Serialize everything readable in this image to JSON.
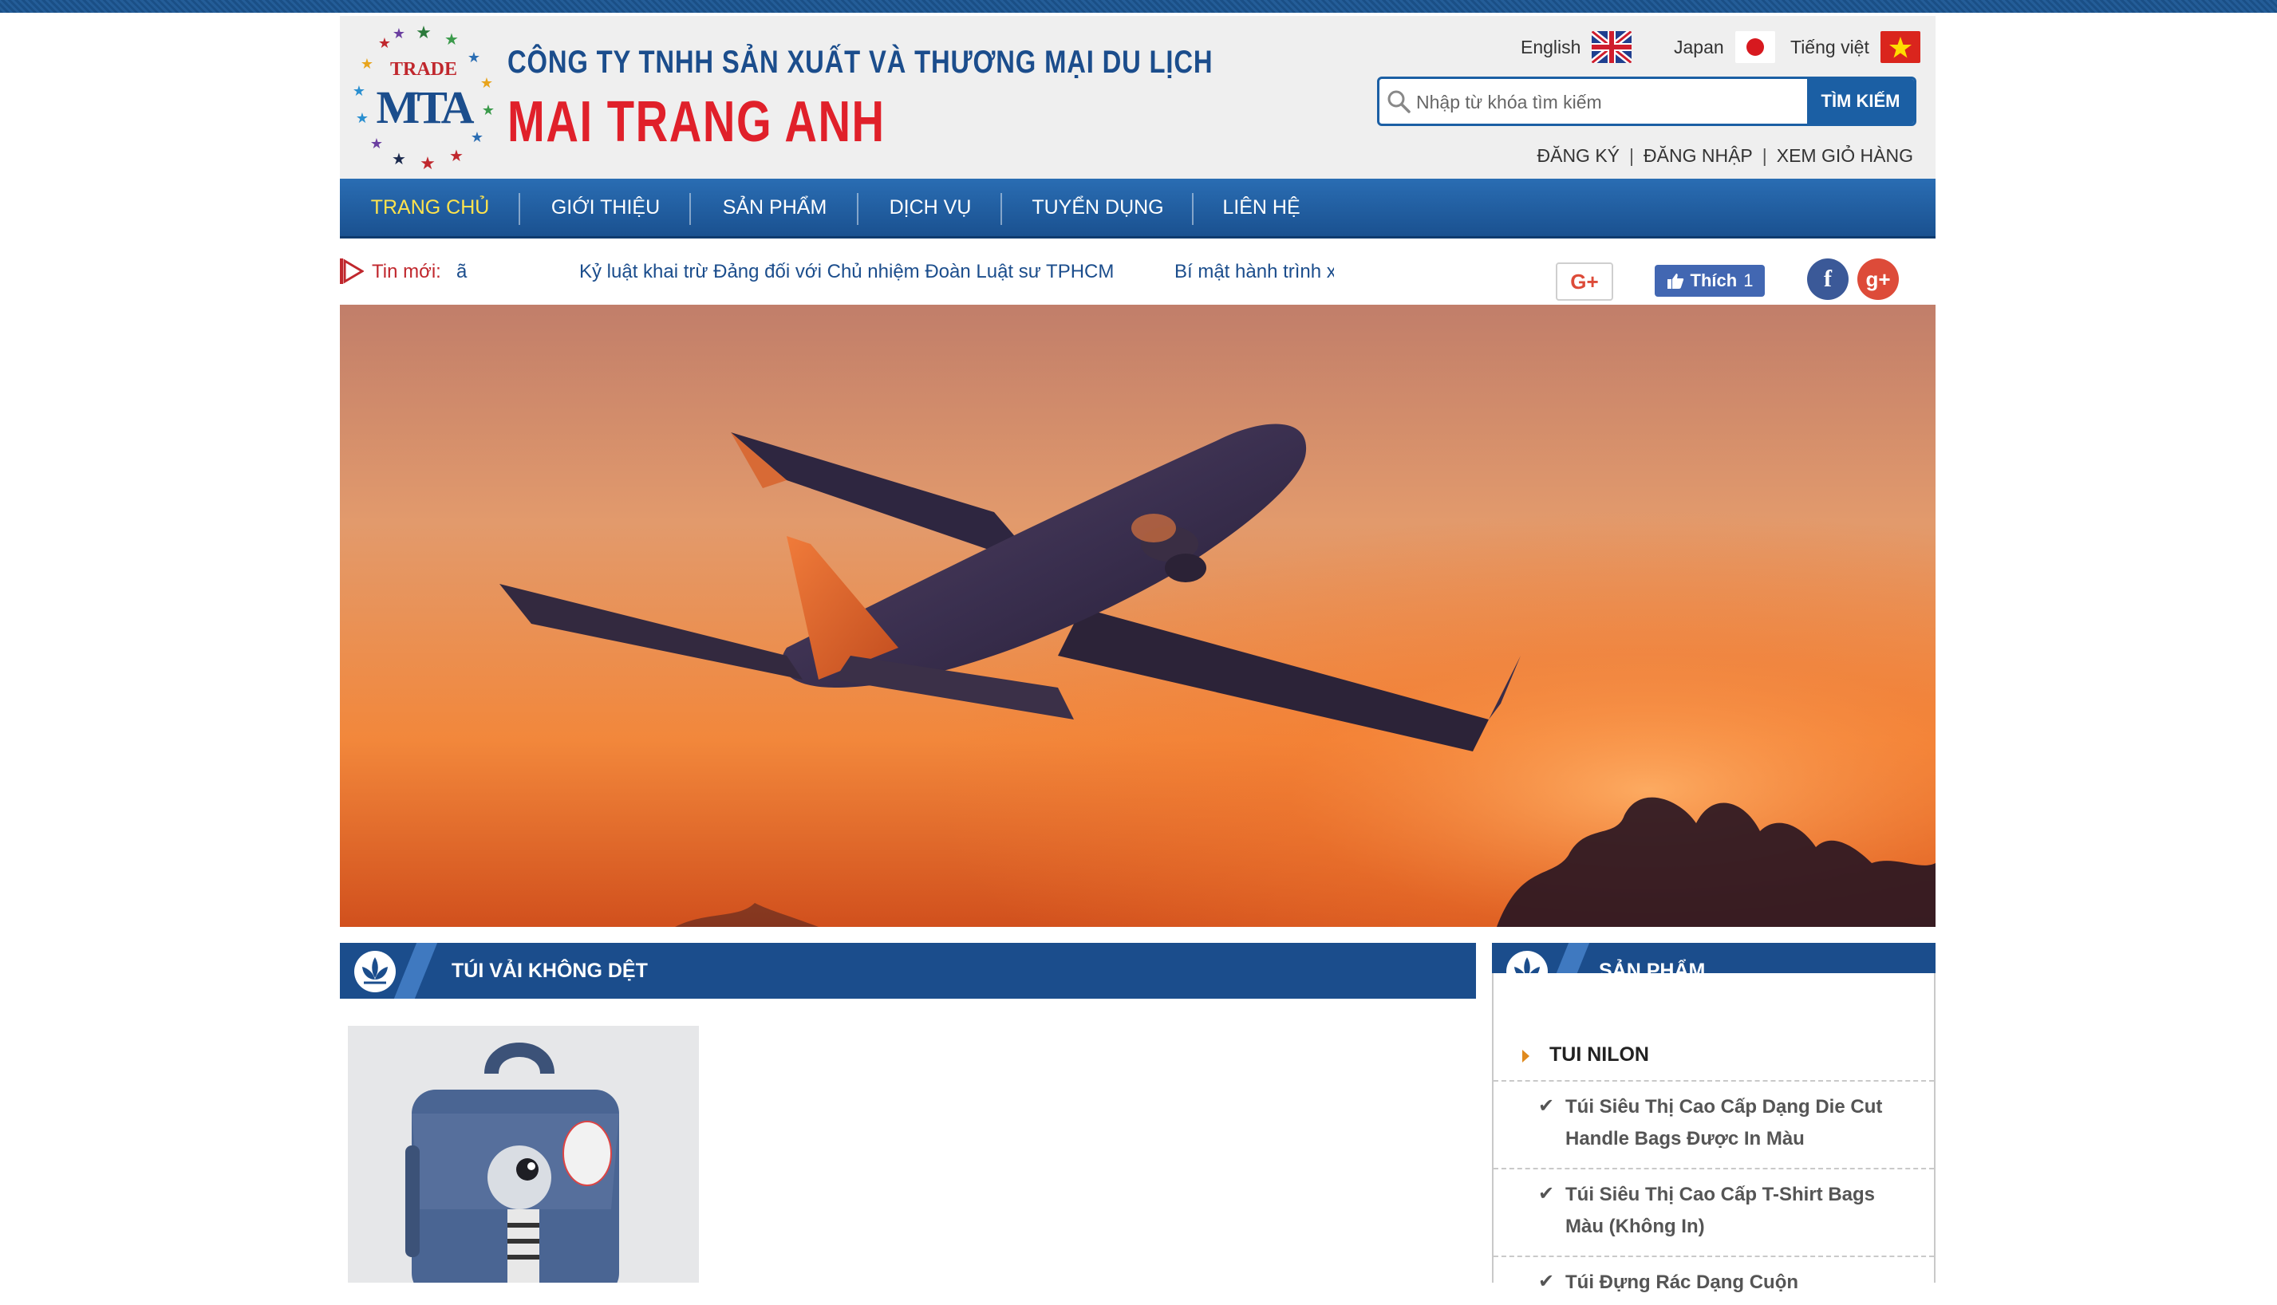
{
  "company": {
    "logo_text_top": "TRADE",
    "logo_text_mark": "MTA",
    "line1": "CÔNG TY TNHH SẢN XUẤT VÀ THƯƠNG MẠI DU LỊCH",
    "line2": "MAI TRANG ANH"
  },
  "languages": [
    {
      "label": "English",
      "flag": "uk-flag"
    },
    {
      "label": "Japan",
      "flag": "japan-flag"
    },
    {
      "label": "Tiếng việt",
      "flag": "vietnam-flag"
    }
  ],
  "search": {
    "placeholder": "Nhập từ khóa tìm kiếm",
    "button_label": "TÌM KIẾM"
  },
  "account": {
    "register": "ĐĂNG KÝ",
    "separator": "|",
    "login": "ĐĂNG NHẬP",
    "cart": "XEM GIỎ HÀNG"
  },
  "nav": {
    "items": [
      {
        "label": "TRANG CHỦ",
        "active": true
      },
      {
        "label": "GIỚI THIỆU",
        "active": false
      },
      {
        "label": "SẢN PHẨM",
        "active": false
      },
      {
        "label": "DỊCH VỤ",
        "active": false
      },
      {
        "label": "TUYỂN DỤNG",
        "active": false
      },
      {
        "label": "LIÊN HỆ",
        "active": false
      }
    ]
  },
  "ticker": {
    "label": "Tin mới:",
    "fragment": "ã",
    "items": [
      "Kỷ luật khai trừ Đảng đối với Chủ nhiệm Đoàn Luật sư TPHCM",
      "Bí mật hành trình xe đúng"
    ]
  },
  "social": {
    "gplus_label": "G+",
    "like_label": "Thích",
    "like_count": "1",
    "facebook_glyph": "f",
    "gplus_glyph": "g+"
  },
  "sections": {
    "main_title": "TÚI VẢI KHÔNG DỆT",
    "side_title": "SẢN PHẨM"
  },
  "sidebar": {
    "category": "TUI NILON",
    "items": [
      "Túi Siêu Thị Cao Cấp Dạng Die Cut Handle Bags Được In Màu",
      "Túi Siêu Thị Cao Cấp T-Shirt Bags Màu (Không In)",
      "Túi Đựng Rác Dạng Cuộn"
    ]
  },
  "colors": {
    "brand_blue": "#1b4d8c",
    "brand_red": "#e0202a",
    "nav_active": "#ffe34d",
    "accent_orange": "#e08a1e"
  }
}
